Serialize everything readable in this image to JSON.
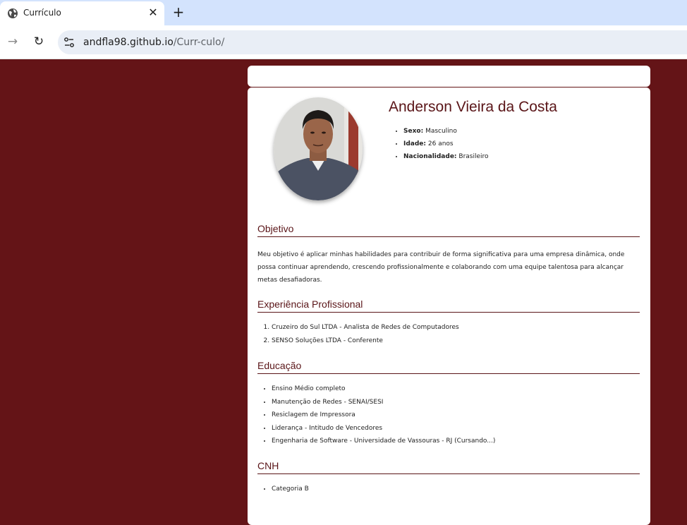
{
  "browser": {
    "tab_title": "Currículo",
    "tab_close": "✕",
    "new_tab": "+",
    "url_host": "andfla98.github.io",
    "url_path": "/Curr-culo/",
    "forward": "→",
    "reload": "↻"
  },
  "profile": {
    "name": "Anderson Vieira da Costa",
    "details": [
      {
        "label": "Sexo:",
        "value": "Masculino"
      },
      {
        "label": "Idade:",
        "value": "26 anos"
      },
      {
        "label": "Nacionalidade:",
        "value": "Brasileiro"
      }
    ]
  },
  "sections": {
    "objective": {
      "title": "Objetivo",
      "text": "Meu objetivo é aplicar minhas habilidades para contribuir de forma significativa para uma empresa dinâmica, onde possa continuar aprendendo, crescendo profissionalmente e colaborando com uma equipe talentosa para alcançar metas desafiadoras."
    },
    "experience": {
      "title": "Experiência Profissional",
      "items": [
        "Cruzeiro do Sul LTDA - Analista de Redes de Computadores",
        "SENSO Soluções LTDA - Conferente"
      ]
    },
    "education": {
      "title": "Educação",
      "items": [
        "Ensino Médio completo",
        "Manutenção de Redes - SENAI/SESI",
        "Resiclagem de Impressora",
        "Liderança - Intitudo de Vencedores",
        "Engenharia de Software - Universidade de Vassouras - RJ (Cursando...)"
      ]
    },
    "cnh": {
      "title": "CNH",
      "items": [
        "Categoria B"
      ]
    }
  },
  "colors": {
    "page_background": "#641417",
    "accent": "#5a1518",
    "tabstrip": "#d3e3fd"
  }
}
